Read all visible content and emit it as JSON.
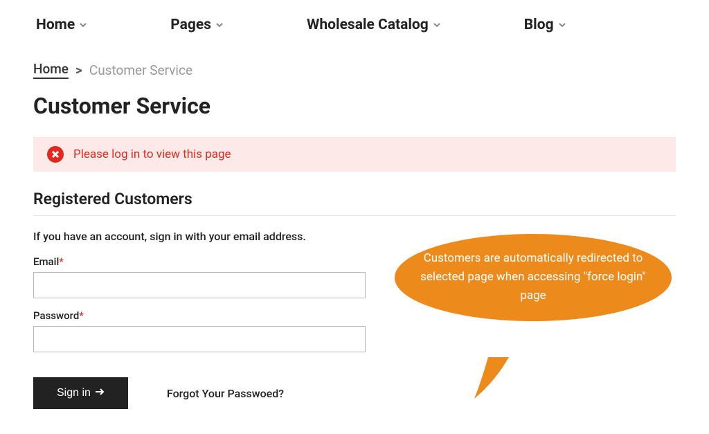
{
  "nav": [
    {
      "label": "Home"
    },
    {
      "label": "Pages"
    },
    {
      "label": "Wholesale Catalog"
    },
    {
      "label": "Blog"
    }
  ],
  "breadcrumb": {
    "link": "Home",
    "separator": ">",
    "current": "Customer Service"
  },
  "page_title": "Customer Service",
  "alert": {
    "message": "Please log in to view this page"
  },
  "login_section": {
    "title": "Registered Customers",
    "intro": "If you have an account, sign in with your email address.",
    "email_label": "Email",
    "password_label": "Password",
    "required_mark": "*",
    "signin_label": "Sign in",
    "forgot_label": "Forgot Your Passwoed?"
  },
  "callout": {
    "text": "Customers are automatically redirected to selected page when accessing \"force login\" page"
  }
}
